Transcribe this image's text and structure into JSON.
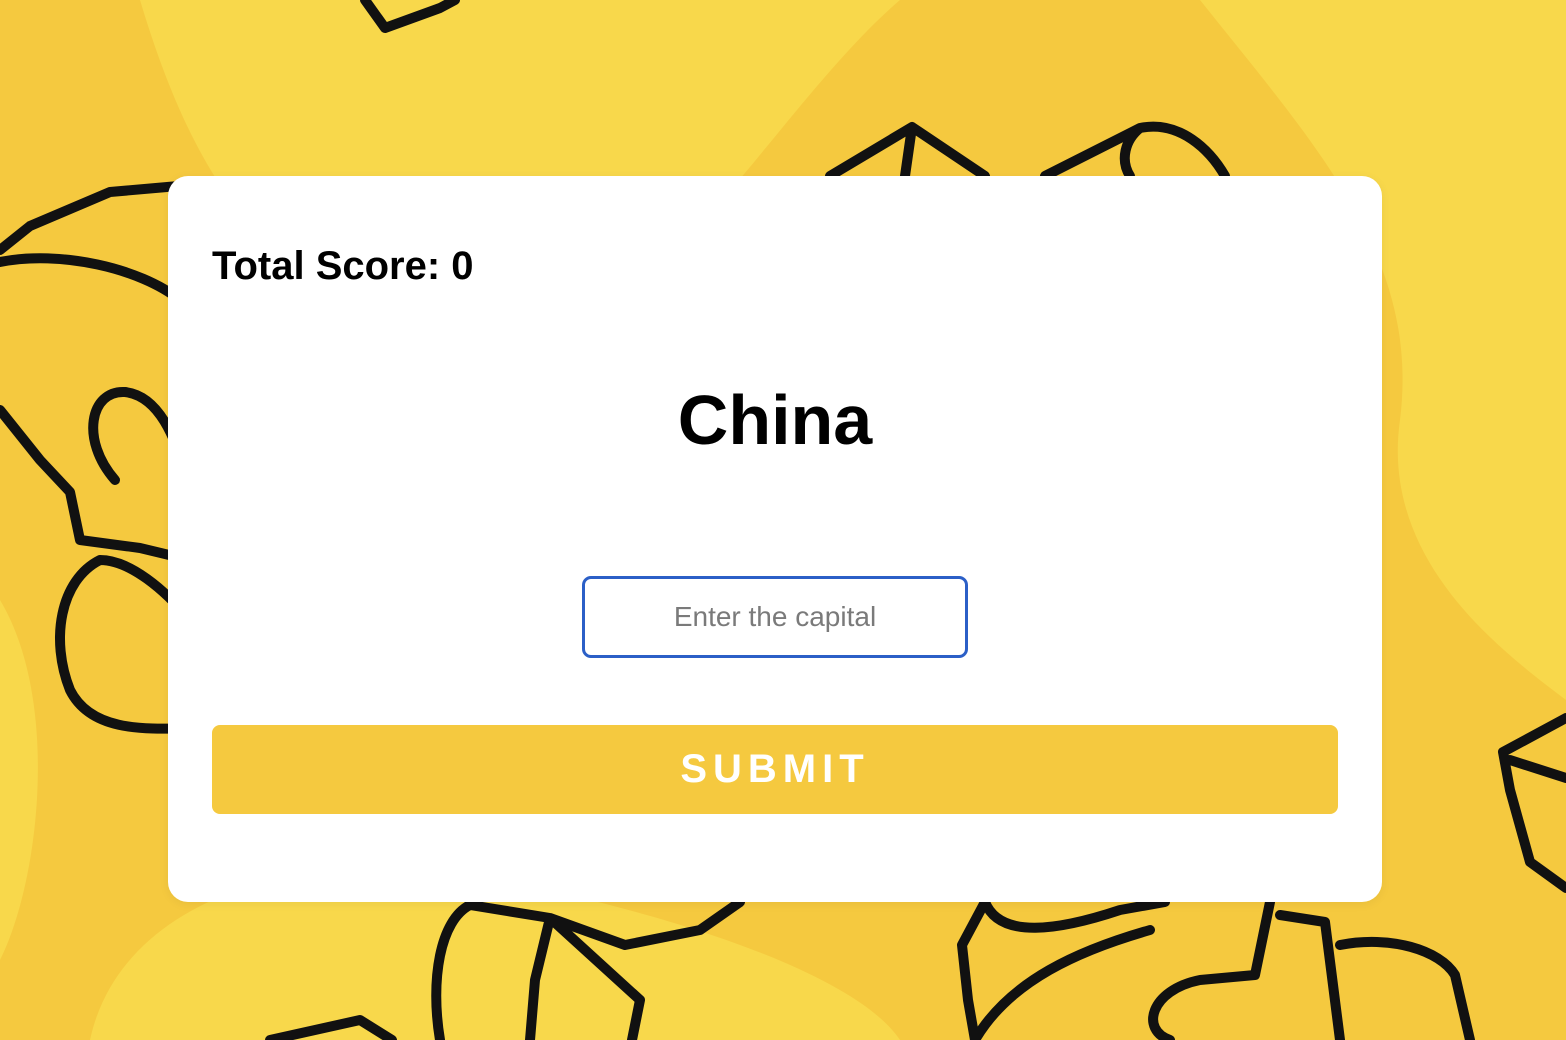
{
  "score": {
    "text": "Total Score: 0"
  },
  "question": {
    "country": "China"
  },
  "answer": {
    "value": "",
    "placeholder": "Enter the capital"
  },
  "submit": {
    "label": "SUBMIT"
  },
  "colors": {
    "background": "#f5c93f",
    "background_light": "#f8d84b",
    "doodle_stroke": "#111111",
    "card": "#ffffff",
    "input_border": "#2b5fc7",
    "button": "#f5c93f",
    "button_text": "#ffffff"
  },
  "icons": {
    "background_pattern": "cheese-doodle-pattern"
  }
}
